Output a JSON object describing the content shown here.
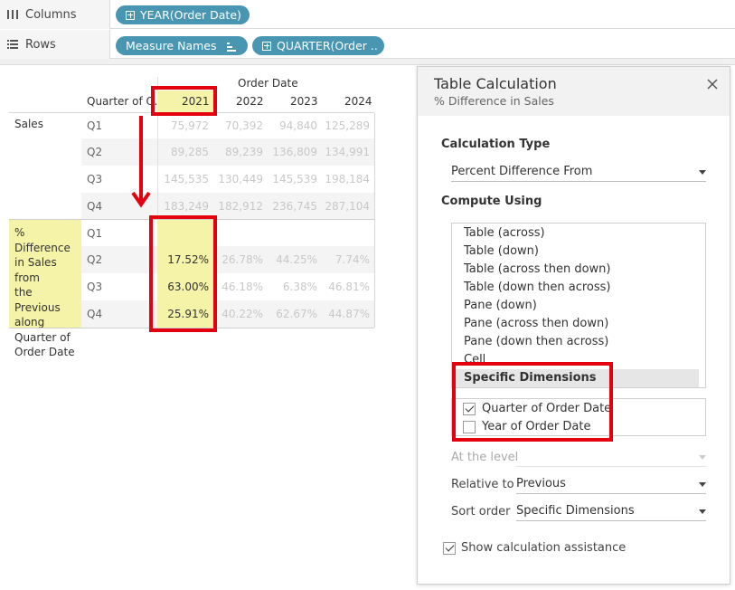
{
  "shelves": {
    "columns": {
      "label": "Columns",
      "pills": [
        "YEAR(Order Date)"
      ]
    },
    "rows": {
      "label": "Rows",
      "pills": [
        "Measure Names",
        "QUARTER(Order .."
      ]
    }
  },
  "table": {
    "column_header_title": "Order Date",
    "row_header": "Quarter of O..",
    "years": [
      "2021",
      "2022",
      "2023",
      "2024"
    ],
    "measures": [
      {
        "name": "Sales",
        "rows": [
          {
            "quarter": "Q1",
            "values": [
              "75,972",
              "70,392",
              "94,840",
              "125,289"
            ]
          },
          {
            "quarter": "Q2",
            "values": [
              "89,285",
              "89,239",
              "136,809",
              "134,991"
            ]
          },
          {
            "quarter": "Q3",
            "values": [
              "145,535",
              "130,449",
              "145,539",
              "198,184"
            ]
          },
          {
            "quarter": "Q4",
            "values": [
              "183,249",
              "182,912",
              "236,745",
              "287,104"
            ]
          }
        ]
      },
      {
        "name": "% Difference in Sales from the Previous along Quarter of Order Date",
        "name_lines": [
          "% Difference",
          "in Sales from",
          "the Previous",
          "along",
          "Quarter of",
          "Order Date"
        ],
        "rows": [
          {
            "quarter": "Q1",
            "values": [
              "",
              "",
              "",
              ""
            ]
          },
          {
            "quarter": "Q2",
            "values": [
              "17.52%",
              "26.78%",
              "44.25%",
              "7.74%"
            ]
          },
          {
            "quarter": "Q3",
            "values": [
              "63.00%",
              "46.18%",
              "6.38%",
              "46.81%"
            ]
          },
          {
            "quarter": "Q4",
            "values": [
              "25.91%",
              "40.22%",
              "62.67%",
              "44.87%"
            ]
          }
        ]
      }
    ]
  },
  "panel": {
    "title": "Table Calculation",
    "subtitle": "% Difference in Sales",
    "calculation_type_label": "Calculation Type",
    "calculation_type_value": "Percent Difference From",
    "compute_using_label": "Compute Using",
    "compute_options": [
      "Table (across)",
      "Table (down)",
      "Table (across then down)",
      "Table (down then across)",
      "Pane (down)",
      "Pane (across then down)",
      "Pane (down then across)",
      "Cell",
      "Specific Dimensions"
    ],
    "selected_option": "Specific Dimensions",
    "dimensions": [
      {
        "label": "Quarter of Order Date",
        "checked": true
      },
      {
        "label": "Year of Order Date",
        "checked": false
      }
    ],
    "at_the_level_label": "At the level",
    "relative_to_label": "Relative to",
    "relative_to_value": "Previous",
    "sort_order_label": "Sort order",
    "sort_order_value": "Specific Dimensions",
    "show_assistance_label": "Show calculation assistance",
    "show_assistance_checked": true
  },
  "colors": {
    "pill": "#4996b2",
    "highlight": "#f5f3a8",
    "annotation": "#e3000f"
  },
  "icons": [
    "columns-icon",
    "rows-icon",
    "close-icon",
    "sort-icon",
    "arrow-down-icon"
  ]
}
